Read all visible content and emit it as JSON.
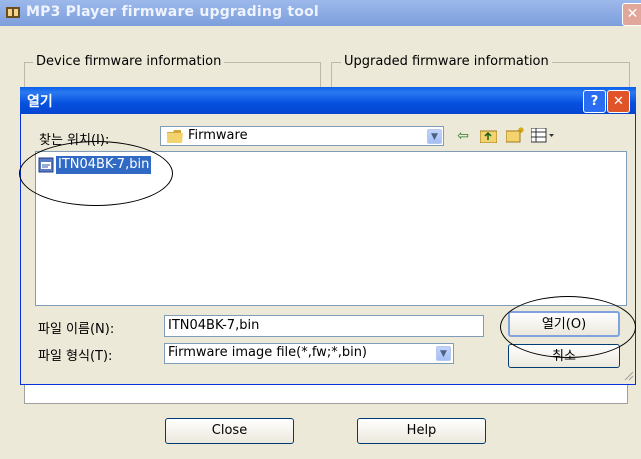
{
  "outer_window": {
    "title": "MP3 Player firmware upgrading tool",
    "close_glyph": "✕",
    "group_device": "Device firmware information",
    "group_upgraded": "Upgraded firmware information",
    "close_button": "Close",
    "help_button": "Help"
  },
  "dialog": {
    "title": "열기",
    "help_glyph": "?",
    "close_glyph": "✕",
    "look_in_label": "찾는 위치(I):",
    "look_in_value": "Firmware",
    "files": [
      {
        "name": "ITN04BK-7,bin",
        "selected": true
      }
    ],
    "filename_label": "파일 이름(N):",
    "filename_value": "ITN04BK-7,bin",
    "filetype_label": "파일 형식(T):",
    "filetype_value": "Firmware image file(*,fw;*,bin)",
    "open_button": "열기(O)",
    "cancel_button": "취소",
    "toolbar_icons": [
      "back-arrow-icon",
      "up-folder-icon",
      "new-folder-icon",
      "view-menu-icon"
    ]
  },
  "colors": {
    "dialog_title_bar": "#0551e0",
    "selection": "#316ac5",
    "window_bg": "#ECE9D8"
  }
}
